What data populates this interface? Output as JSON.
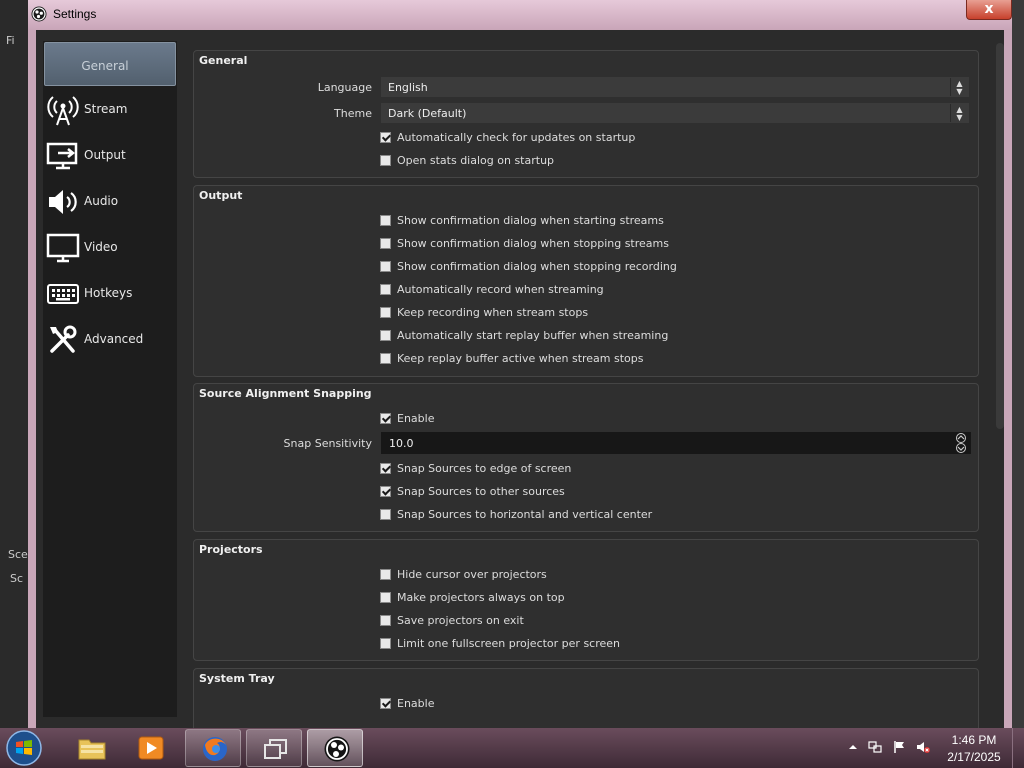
{
  "window": {
    "title": "Settings",
    "close_glyph": "x"
  },
  "background_app": {
    "menu_fragment": "Fi",
    "dock_title": "Sce",
    "dock_item": "Sc"
  },
  "sidebar": {
    "items": [
      {
        "label": "General",
        "icon": "gear-icon",
        "selected": true
      },
      {
        "label": "Stream",
        "icon": "broadcast-tower-icon"
      },
      {
        "label": "Output",
        "icon": "output-monitor-icon"
      },
      {
        "label": "Audio",
        "icon": "speaker-icon"
      },
      {
        "label": "Video",
        "icon": "monitor-icon"
      },
      {
        "label": "Hotkeys",
        "icon": "keyboard-icon"
      },
      {
        "label": "Advanced",
        "icon": "tools-icon"
      }
    ]
  },
  "general": {
    "title": "General",
    "language_label": "Language",
    "language_value": "English",
    "theme_label": "Theme",
    "theme_value": "Dark (Default)",
    "check_updates": {
      "label": "Automatically check for updates on startup",
      "checked": true
    },
    "open_stats": {
      "label": "Open stats dialog on startup",
      "checked": false
    }
  },
  "output": {
    "title": "Output",
    "options": [
      {
        "label": "Show confirmation dialog when starting streams",
        "checked": false
      },
      {
        "label": "Show confirmation dialog when stopping streams",
        "checked": false
      },
      {
        "label": "Show confirmation dialog when stopping recording",
        "checked": false
      },
      {
        "label": "Automatically record when streaming",
        "checked": false
      },
      {
        "label": "Keep recording when stream stops",
        "checked": false
      },
      {
        "label": "Automatically start replay buffer when streaming",
        "checked": false
      },
      {
        "label": "Keep replay buffer active when stream stops",
        "checked": false
      }
    ]
  },
  "snapping": {
    "title": "Source Alignment Snapping",
    "enable": {
      "label": "Enable",
      "checked": true
    },
    "sensitivity_label": "Snap Sensitivity",
    "sensitivity_value": "10.0",
    "options": [
      {
        "label": "Snap Sources to edge of screen",
        "checked": true
      },
      {
        "label": "Snap Sources to other sources",
        "checked": true
      },
      {
        "label": "Snap Sources to horizontal and vertical center",
        "checked": false
      }
    ]
  },
  "projectors": {
    "title": "Projectors",
    "options": [
      {
        "label": "Hide cursor over projectors",
        "checked": false
      },
      {
        "label": "Make projectors always on top",
        "checked": false
      },
      {
        "label": "Save projectors on exit",
        "checked": false
      },
      {
        "label": "Limit one fullscreen projector per screen",
        "checked": false
      }
    ]
  },
  "system_tray": {
    "title": "System Tray",
    "enable": {
      "label": "Enable",
      "checked": true
    }
  },
  "taskbar": {
    "start_icon": "windows-start-icon",
    "apps": [
      "file-explorer-icon",
      "media-player-icon",
      "firefox-icon",
      "task-view-icon",
      "obs-icon"
    ],
    "clock_time": "1:46 PM",
    "clock_date": "2/17/2025"
  },
  "colors": {
    "accent_selected": "#5d6b7b",
    "panel": "#2b2b2b",
    "sidebar": "#1d1d1d",
    "titlebar": "#d7b8c9"
  }
}
